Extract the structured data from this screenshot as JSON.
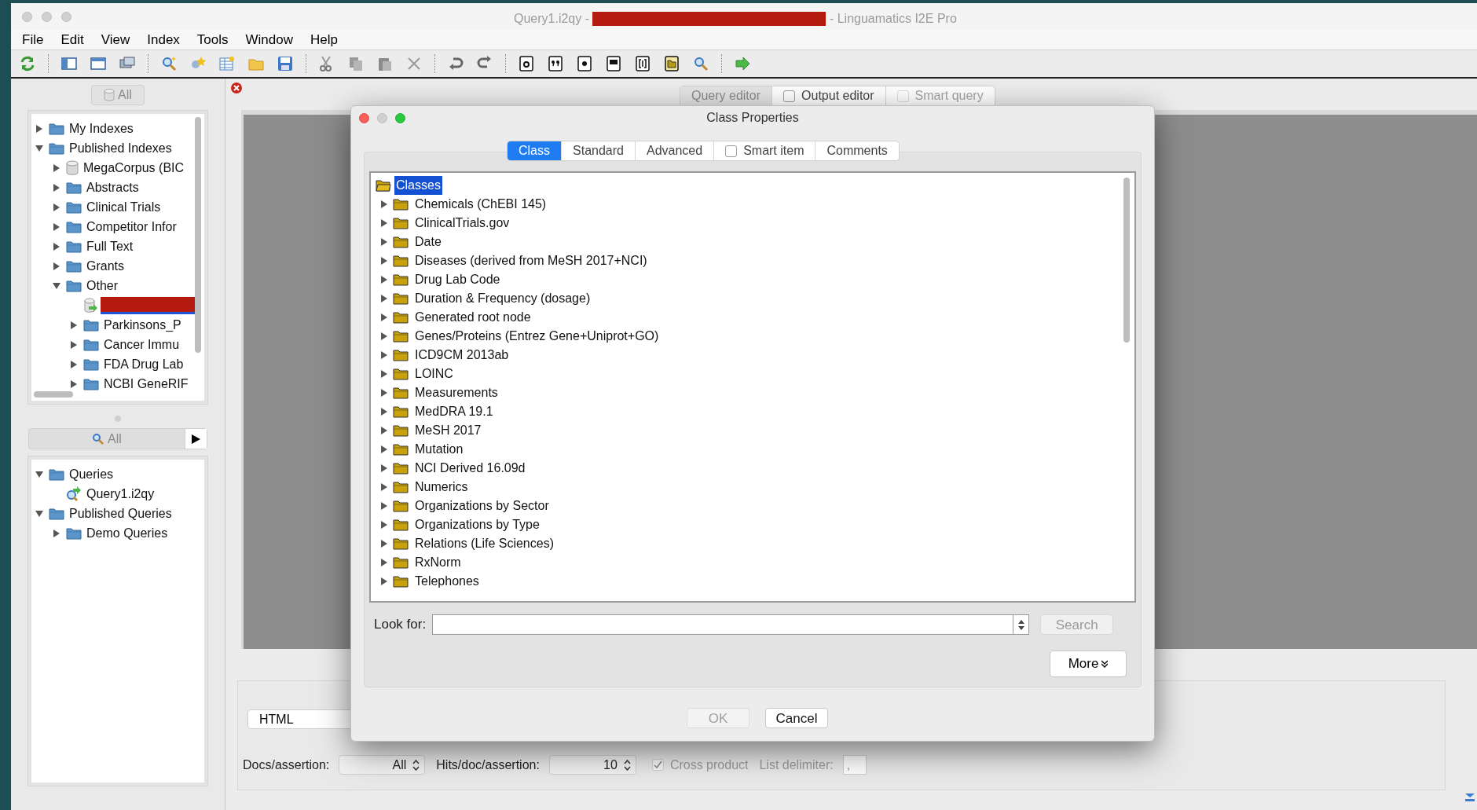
{
  "window": {
    "title_prefix": "Query1.i2qy - ",
    "title_suffix": " - Linguamatics I2E Pro"
  },
  "menu": [
    "File",
    "Edit",
    "View",
    "Index",
    "Tools",
    "Window",
    "Help"
  ],
  "index_panel": {
    "filter_button": "All",
    "tree": [
      {
        "label": "My Indexes",
        "kind": "folder",
        "expanded": false
      },
      {
        "label": "Published Indexes",
        "kind": "folder",
        "expanded": true,
        "children": [
          {
            "label": "MegaCorpus (BIC",
            "kind": "database",
            "expanded": false
          },
          {
            "label": "Abstracts",
            "kind": "folder",
            "expanded": false
          },
          {
            "label": "Clinical Trials",
            "kind": "folder",
            "expanded": false
          },
          {
            "label": "Competitor Infor",
            "kind": "folder",
            "expanded": false
          },
          {
            "label": "Full Text",
            "kind": "folder",
            "expanded": false
          },
          {
            "label": "Grants",
            "kind": "folder",
            "expanded": false
          },
          {
            "label": "Other",
            "kind": "folder",
            "expanded": true,
            "children": [
              {
                "kind": "redacted"
              },
              {
                "label": "Parkinsons_P",
                "kind": "folder",
                "expanded": false
              },
              {
                "label": "Cancer Immu",
                "kind": "folder",
                "expanded": false
              },
              {
                "label": "FDA Drug Lab",
                "kind": "folder",
                "expanded": false
              },
              {
                "label": "NCBI GeneRIF",
                "kind": "folder",
                "expanded": false
              }
            ]
          }
        ]
      }
    ]
  },
  "query_panel": {
    "filter_button": "All",
    "tree": [
      {
        "label": "Queries",
        "kind": "folder",
        "expanded": true,
        "children": [
          {
            "label": "Query1.i2qy",
            "kind": "query"
          }
        ]
      },
      {
        "label": "Published Queries",
        "kind": "folder",
        "expanded": true,
        "children": [
          {
            "label": "Demo Queries",
            "kind": "folder",
            "expanded": false
          }
        ]
      }
    ]
  },
  "editor_tabs": [
    {
      "label": "Query editor",
      "kind": "tab",
      "selected": true
    },
    {
      "label": "Output editor",
      "kind": "checkbox",
      "selected": false,
      "checked": false,
      "disabled": false
    },
    {
      "label": "Smart query",
      "kind": "checkbox",
      "selected": false,
      "checked": false,
      "disabled": true
    }
  ],
  "output_panel": {
    "format": "HTML",
    "docs_label": "Docs/assertion:",
    "docs_value": "All",
    "hits_label": "Hits/doc/assertion:",
    "hits_value": "10",
    "cross_product": {
      "label": "Cross product",
      "checked": true,
      "disabled": true
    },
    "delimiter_label": "List delimiter:",
    "delimiter_value": ","
  },
  "dialog": {
    "title": "Class Properties",
    "tabs": [
      {
        "label": "Class",
        "kind": "tab",
        "selected": true
      },
      {
        "label": "Standard",
        "kind": "tab",
        "selected": false
      },
      {
        "label": "Advanced",
        "kind": "tab",
        "selected": false
      },
      {
        "label": "Smart item",
        "kind": "checkbox",
        "selected": false,
        "checked": false
      },
      {
        "label": "Comments",
        "kind": "tab",
        "selected": false
      }
    ],
    "root": {
      "label": "Classes",
      "selected": true
    },
    "classes": [
      {
        "label": "Chemicals (ChEBI 145)",
        "expanded": false
      },
      {
        "label": "ClinicalTrials.gov",
        "expanded": false
      },
      {
        "label": "Date",
        "expanded": false
      },
      {
        "label": "Diseases (derived from MeSH 2017+NCI)",
        "expanded": false
      },
      {
        "label": "Drug Lab Code",
        "expanded": false
      },
      {
        "label": "Duration & Frequency (dosage)",
        "expanded": false
      },
      {
        "label": "Generated root node",
        "expanded": false
      },
      {
        "label": "Genes/Proteins (Entrez Gene+Uniprot+GO)",
        "expanded": false
      },
      {
        "label": "ICD9CM 2013ab",
        "expanded": false
      },
      {
        "label": "LOINC",
        "expanded": false
      },
      {
        "label": "Measurements",
        "expanded": false
      },
      {
        "label": "MedDRA 19.1",
        "expanded": false
      },
      {
        "label": "MeSH 2017",
        "expanded": false
      },
      {
        "label": "Mutation",
        "expanded": false
      },
      {
        "label": "NCI Derived 16.09d",
        "expanded": false
      },
      {
        "label": "Numerics",
        "expanded": false
      },
      {
        "label": "Organizations by Sector",
        "expanded": false
      },
      {
        "label": "Organizations by Type",
        "expanded": false
      },
      {
        "label": "Relations (Life Sciences)",
        "expanded": false
      },
      {
        "label": "RxNorm",
        "expanded": false
      },
      {
        "label": "Telephones",
        "expanded": false
      }
    ],
    "look_for_label": "Look for:",
    "search_button": {
      "label": "Search",
      "disabled": true
    },
    "more_button": "More",
    "buttons": [
      {
        "label": "OK",
        "disabled": true
      },
      {
        "label": "Cancel",
        "disabled": false
      }
    ]
  }
}
